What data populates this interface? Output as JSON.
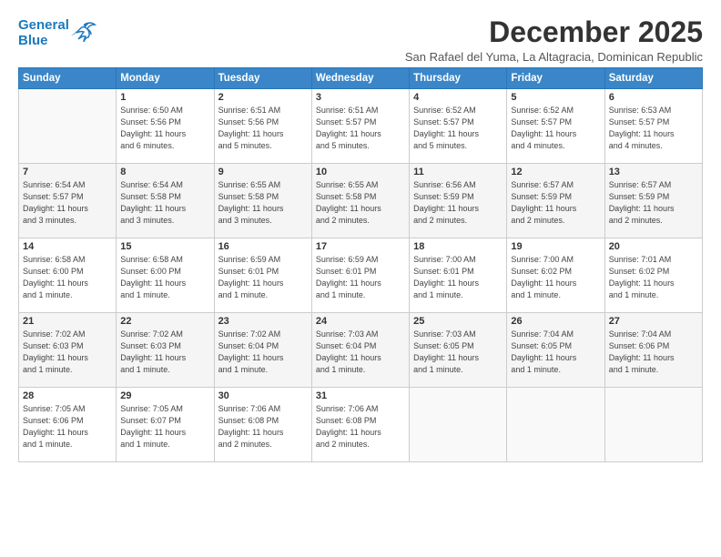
{
  "logo": {
    "line1": "General",
    "line2": "Blue"
  },
  "title": "December 2025",
  "subtitle": "San Rafael del Yuma, La Altagracia, Dominican Republic",
  "headers": [
    "Sunday",
    "Monday",
    "Tuesday",
    "Wednesday",
    "Thursday",
    "Friday",
    "Saturday"
  ],
  "weeks": [
    [
      {
        "day": "",
        "info": ""
      },
      {
        "day": "1",
        "info": "Sunrise: 6:50 AM\nSunset: 5:56 PM\nDaylight: 11 hours\nand 6 minutes."
      },
      {
        "day": "2",
        "info": "Sunrise: 6:51 AM\nSunset: 5:56 PM\nDaylight: 11 hours\nand 5 minutes."
      },
      {
        "day": "3",
        "info": "Sunrise: 6:51 AM\nSunset: 5:57 PM\nDaylight: 11 hours\nand 5 minutes."
      },
      {
        "day": "4",
        "info": "Sunrise: 6:52 AM\nSunset: 5:57 PM\nDaylight: 11 hours\nand 5 minutes."
      },
      {
        "day": "5",
        "info": "Sunrise: 6:52 AM\nSunset: 5:57 PM\nDaylight: 11 hours\nand 4 minutes."
      },
      {
        "day": "6",
        "info": "Sunrise: 6:53 AM\nSunset: 5:57 PM\nDaylight: 11 hours\nand 4 minutes."
      }
    ],
    [
      {
        "day": "7",
        "info": "Sunrise: 6:54 AM\nSunset: 5:57 PM\nDaylight: 11 hours\nand 3 minutes."
      },
      {
        "day": "8",
        "info": "Sunrise: 6:54 AM\nSunset: 5:58 PM\nDaylight: 11 hours\nand 3 minutes."
      },
      {
        "day": "9",
        "info": "Sunrise: 6:55 AM\nSunset: 5:58 PM\nDaylight: 11 hours\nand 3 minutes."
      },
      {
        "day": "10",
        "info": "Sunrise: 6:55 AM\nSunset: 5:58 PM\nDaylight: 11 hours\nand 2 minutes."
      },
      {
        "day": "11",
        "info": "Sunrise: 6:56 AM\nSunset: 5:59 PM\nDaylight: 11 hours\nand 2 minutes."
      },
      {
        "day": "12",
        "info": "Sunrise: 6:57 AM\nSunset: 5:59 PM\nDaylight: 11 hours\nand 2 minutes."
      },
      {
        "day": "13",
        "info": "Sunrise: 6:57 AM\nSunset: 5:59 PM\nDaylight: 11 hours\nand 2 minutes."
      }
    ],
    [
      {
        "day": "14",
        "info": "Sunrise: 6:58 AM\nSunset: 6:00 PM\nDaylight: 11 hours\nand 1 minute."
      },
      {
        "day": "15",
        "info": "Sunrise: 6:58 AM\nSunset: 6:00 PM\nDaylight: 11 hours\nand 1 minute."
      },
      {
        "day": "16",
        "info": "Sunrise: 6:59 AM\nSunset: 6:01 PM\nDaylight: 11 hours\nand 1 minute."
      },
      {
        "day": "17",
        "info": "Sunrise: 6:59 AM\nSunset: 6:01 PM\nDaylight: 11 hours\nand 1 minute."
      },
      {
        "day": "18",
        "info": "Sunrise: 7:00 AM\nSunset: 6:01 PM\nDaylight: 11 hours\nand 1 minute."
      },
      {
        "day": "19",
        "info": "Sunrise: 7:00 AM\nSunset: 6:02 PM\nDaylight: 11 hours\nand 1 minute."
      },
      {
        "day": "20",
        "info": "Sunrise: 7:01 AM\nSunset: 6:02 PM\nDaylight: 11 hours\nand 1 minute."
      }
    ],
    [
      {
        "day": "21",
        "info": "Sunrise: 7:02 AM\nSunset: 6:03 PM\nDaylight: 11 hours\nand 1 minute."
      },
      {
        "day": "22",
        "info": "Sunrise: 7:02 AM\nSunset: 6:03 PM\nDaylight: 11 hours\nand 1 minute."
      },
      {
        "day": "23",
        "info": "Sunrise: 7:02 AM\nSunset: 6:04 PM\nDaylight: 11 hours\nand 1 minute."
      },
      {
        "day": "24",
        "info": "Sunrise: 7:03 AM\nSunset: 6:04 PM\nDaylight: 11 hours\nand 1 minute."
      },
      {
        "day": "25",
        "info": "Sunrise: 7:03 AM\nSunset: 6:05 PM\nDaylight: 11 hours\nand 1 minute."
      },
      {
        "day": "26",
        "info": "Sunrise: 7:04 AM\nSunset: 6:05 PM\nDaylight: 11 hours\nand 1 minute."
      },
      {
        "day": "27",
        "info": "Sunrise: 7:04 AM\nSunset: 6:06 PM\nDaylight: 11 hours\nand 1 minute."
      }
    ],
    [
      {
        "day": "28",
        "info": "Sunrise: 7:05 AM\nSunset: 6:06 PM\nDaylight: 11 hours\nand 1 minute."
      },
      {
        "day": "29",
        "info": "Sunrise: 7:05 AM\nSunset: 6:07 PM\nDaylight: 11 hours\nand 1 minute."
      },
      {
        "day": "30",
        "info": "Sunrise: 7:06 AM\nSunset: 6:08 PM\nDaylight: 11 hours\nand 2 minutes."
      },
      {
        "day": "31",
        "info": "Sunrise: 7:06 AM\nSunset: 6:08 PM\nDaylight: 11 hours\nand 2 minutes."
      },
      {
        "day": "",
        "info": ""
      },
      {
        "day": "",
        "info": ""
      },
      {
        "day": "",
        "info": ""
      }
    ]
  ]
}
